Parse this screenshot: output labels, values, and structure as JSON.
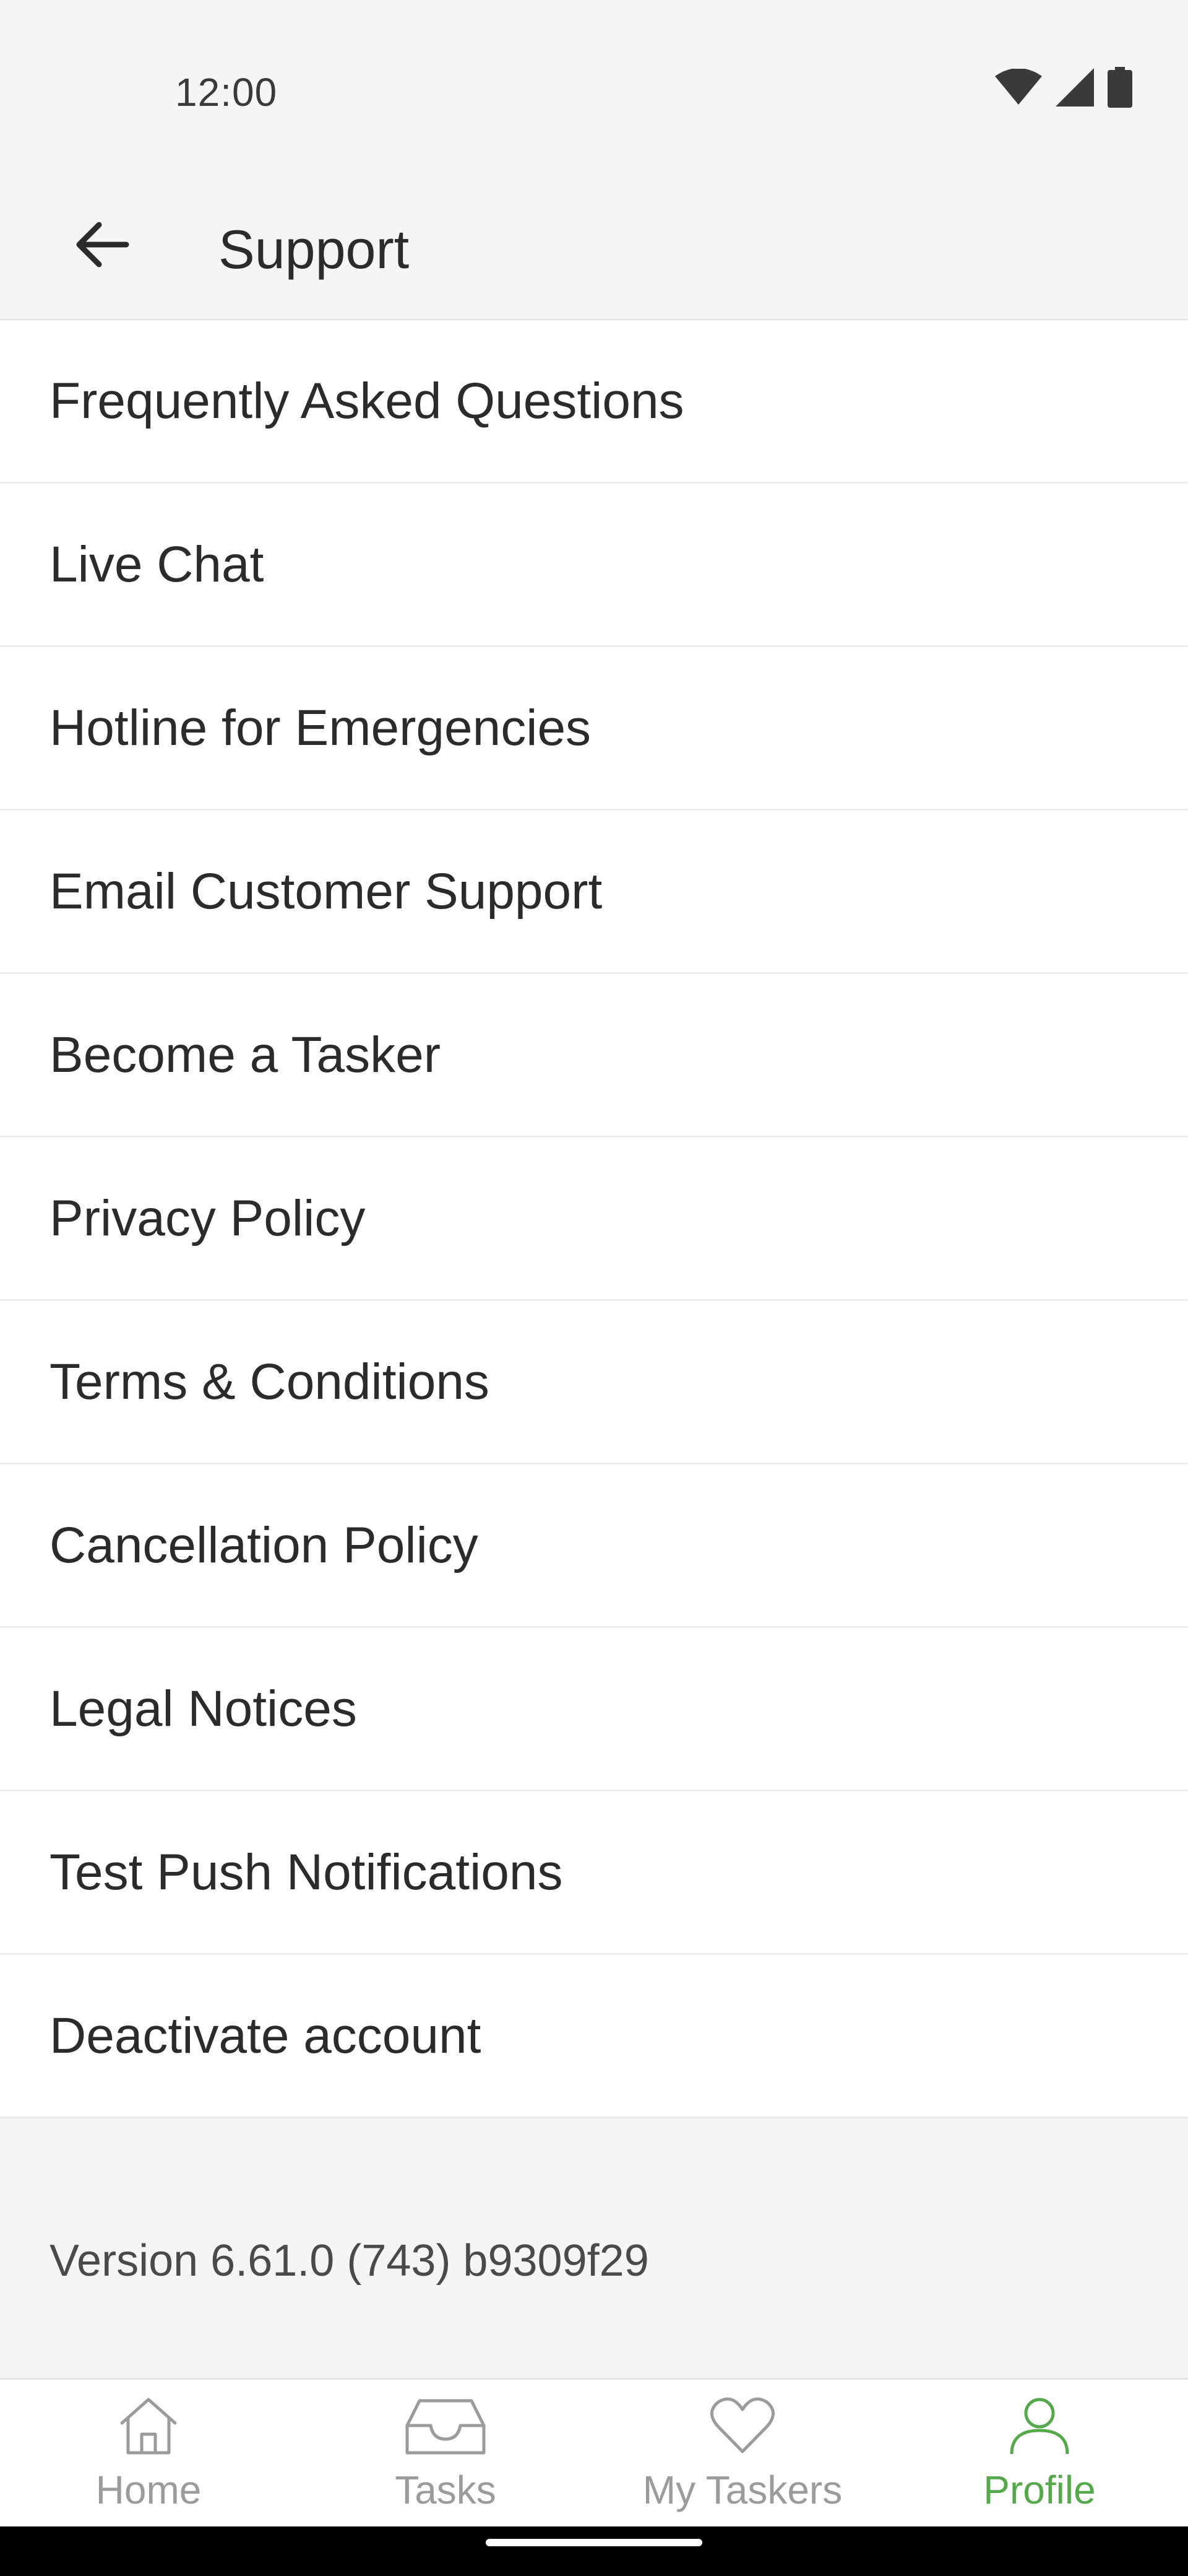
{
  "status_bar": {
    "time": "12:00",
    "icons": [
      "wifi-icon",
      "signal-icon",
      "battery-icon"
    ]
  },
  "app_bar": {
    "title": "Support",
    "back_icon": "arrow-left-icon"
  },
  "menu": {
    "items": [
      {
        "label": "Frequently Asked Questions"
      },
      {
        "label": "Live Chat"
      },
      {
        "label": "Hotline for Emergencies"
      },
      {
        "label": "Email Customer Support"
      },
      {
        "label": "Become a Tasker"
      },
      {
        "label": "Privacy Policy"
      },
      {
        "label": "Terms & Conditions"
      },
      {
        "label": "Cancellation Policy"
      },
      {
        "label": "Legal Notices"
      },
      {
        "label": "Test Push Notifications"
      },
      {
        "label": "Deactivate account"
      }
    ]
  },
  "version_text": "Version 6.61.0 (743) b9309f29",
  "bottom_nav": {
    "active_color": "#55a94b",
    "inactive_color": "#9b9b9b",
    "items": [
      {
        "label": "Home",
        "icon": "home-icon",
        "active": false
      },
      {
        "label": "Tasks",
        "icon": "inbox-icon",
        "active": false
      },
      {
        "label": "My Taskers",
        "icon": "heart-icon",
        "active": false
      },
      {
        "label": "Profile",
        "icon": "person-icon",
        "active": true
      }
    ]
  }
}
